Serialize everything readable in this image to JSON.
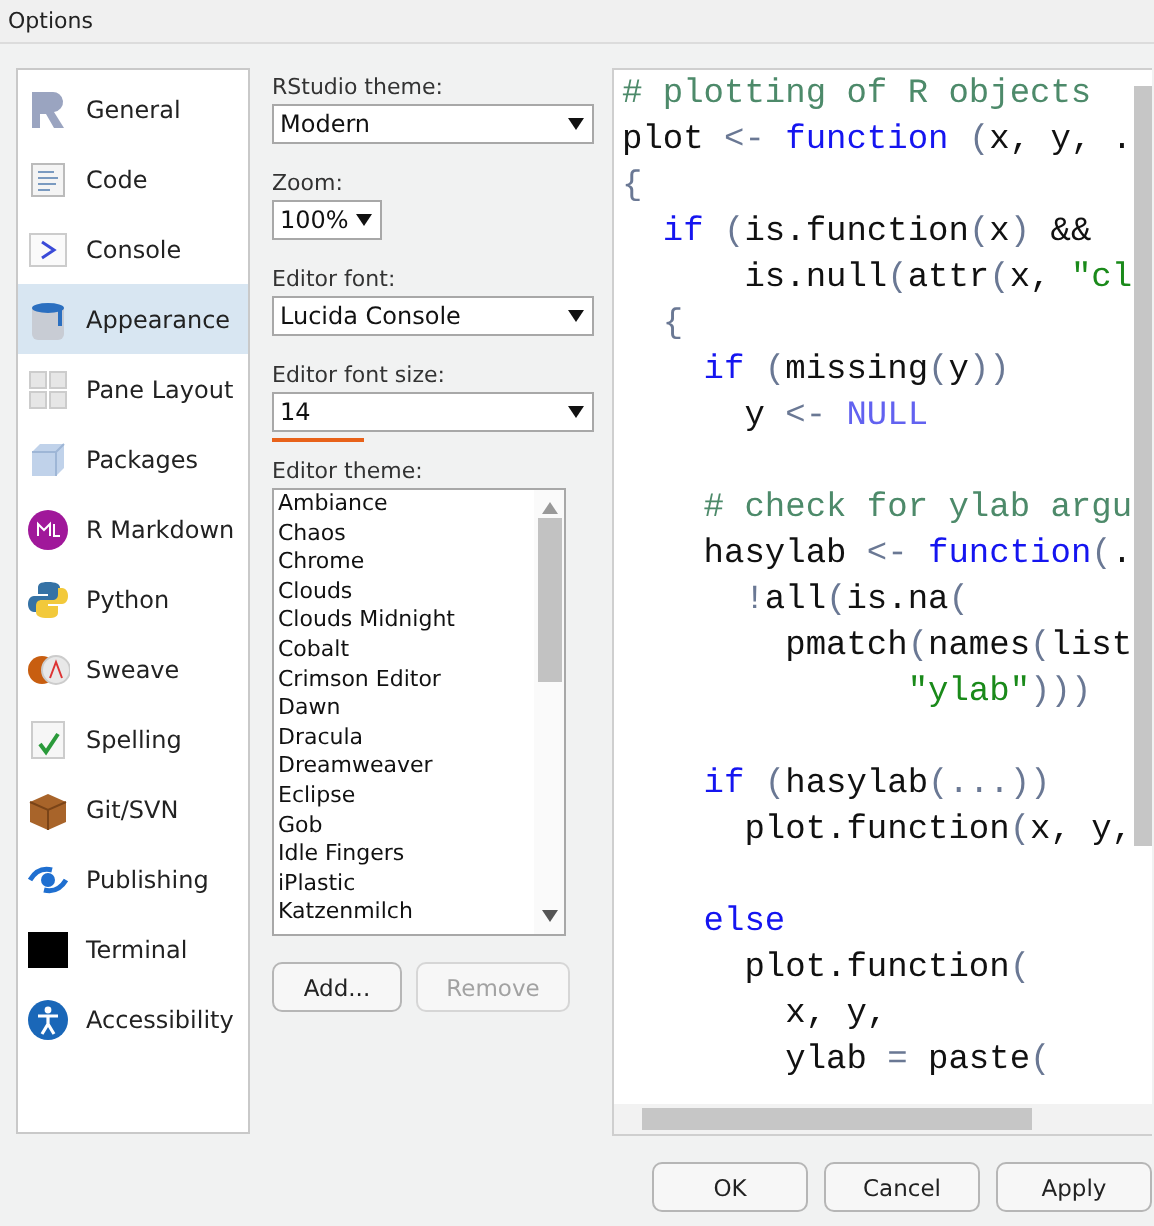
{
  "window": {
    "title": "Options"
  },
  "sidebar": {
    "items": [
      {
        "label": "General",
        "selected": false
      },
      {
        "label": "Code",
        "selected": false
      },
      {
        "label": "Console",
        "selected": false
      },
      {
        "label": "Appearance",
        "selected": true
      },
      {
        "label": "Pane Layout",
        "selected": false
      },
      {
        "label": "Packages",
        "selected": false
      },
      {
        "label": "R Markdown",
        "selected": false
      },
      {
        "label": "Python",
        "selected": false
      },
      {
        "label": "Sweave",
        "selected": false
      },
      {
        "label": "Spelling",
        "selected": false
      },
      {
        "label": "Git/SVN",
        "selected": false
      },
      {
        "label": "Publishing",
        "selected": false
      },
      {
        "label": "Terminal",
        "selected": false
      },
      {
        "label": "Accessibility",
        "selected": false
      }
    ]
  },
  "settings": [
    {
      "label": "RStudio theme:",
      "value": "Modern",
      "wide": true,
      "focused": false
    },
    {
      "label": "Zoom:",
      "value": "100%",
      "wide": false,
      "focused": false
    },
    {
      "label": "Editor font:",
      "value": "Lucida Console",
      "wide": true,
      "focused": false
    },
    {
      "label": "Editor font size:",
      "value": "14",
      "wide": true,
      "focused": true
    }
  ],
  "editor_theme": {
    "label": "Editor theme:",
    "items": [
      "Ambiance",
      "Chaos",
      "Chrome",
      "Clouds",
      "Clouds Midnight",
      "Cobalt",
      "Crimson Editor",
      "Dawn",
      "Dracula",
      "Dreamweaver",
      "Eclipse",
      "Gob",
      "Idle Fingers",
      "iPlastic",
      "Katzenmilch"
    ],
    "buttons": [
      {
        "label": "Add...",
        "disabled": false
      },
      {
        "label": "Remove",
        "disabled": true
      }
    ]
  },
  "preview": {
    "lines": [
      {
        "kind": "code",
        "tokens": [
          {
            "kind": "comment",
            "text": "# plotting of R objects"
          }
        ]
      },
      {
        "kind": "code",
        "tokens": [
          {
            "kind": "plain",
            "text": "plot "
          },
          {
            "kind": "op",
            "text": "<- "
          },
          {
            "kind": "keyword",
            "text": "function"
          },
          {
            "kind": "op",
            "text": " ("
          },
          {
            "kind": "plain",
            "text": "x, y, ."
          }
        ]
      },
      {
        "kind": "code",
        "tokens": [
          {
            "kind": "op",
            "text": "{"
          }
        ]
      },
      {
        "kind": "code",
        "tokens": [
          {
            "kind": "keyword",
            "text": "  if"
          },
          {
            "kind": "op",
            "text": " ("
          },
          {
            "kind": "plain",
            "text": "is.function"
          },
          {
            "kind": "op",
            "text": "("
          },
          {
            "kind": "plain",
            "text": "x"
          },
          {
            "kind": "op",
            "text": ")"
          },
          {
            "kind": "plain",
            "text": " &&"
          }
        ]
      },
      {
        "kind": "code",
        "tokens": [
          {
            "kind": "plain",
            "text": "      is.null"
          },
          {
            "kind": "op",
            "text": "("
          },
          {
            "kind": "plain",
            "text": "attr"
          },
          {
            "kind": "op",
            "text": "("
          },
          {
            "kind": "plain",
            "text": "x, "
          },
          {
            "kind": "string",
            "text": "\"cl"
          }
        ]
      },
      {
        "kind": "code",
        "tokens": [
          {
            "kind": "op",
            "text": "  {"
          }
        ]
      },
      {
        "kind": "code",
        "tokens": [
          {
            "kind": "keyword",
            "text": "    if"
          },
          {
            "kind": "op",
            "text": " ("
          },
          {
            "kind": "plain",
            "text": "missing"
          },
          {
            "kind": "op",
            "text": "("
          },
          {
            "kind": "plain",
            "text": "y"
          },
          {
            "kind": "op",
            "text": "))"
          }
        ]
      },
      {
        "kind": "code",
        "tokens": [
          {
            "kind": "plain",
            "text": "      y "
          },
          {
            "kind": "op",
            "text": "<- "
          },
          {
            "kind": "constant",
            "text": "NULL"
          }
        ]
      },
      {
        "kind": "blank"
      },
      {
        "kind": "code",
        "tokens": [
          {
            "kind": "comment",
            "text": "    # check for ylab argu"
          }
        ]
      },
      {
        "kind": "code",
        "tokens": [
          {
            "kind": "plain",
            "text": "    hasylab "
          },
          {
            "kind": "op",
            "text": "<- "
          },
          {
            "kind": "keyword",
            "text": "function"
          },
          {
            "kind": "op",
            "text": "("
          },
          {
            "kind": "plain",
            "text": "."
          }
        ]
      },
      {
        "kind": "code",
        "tokens": [
          {
            "kind": "op",
            "text": "      !"
          },
          {
            "kind": "plain",
            "text": "all"
          },
          {
            "kind": "op",
            "text": "("
          },
          {
            "kind": "plain",
            "text": "is.na"
          },
          {
            "kind": "op",
            "text": "("
          }
        ]
      },
      {
        "kind": "code",
        "tokens": [
          {
            "kind": "plain",
            "text": "        pmatch"
          },
          {
            "kind": "op",
            "text": "("
          },
          {
            "kind": "plain",
            "text": "names"
          },
          {
            "kind": "op",
            "text": "("
          },
          {
            "kind": "plain",
            "text": "list"
          }
        ]
      },
      {
        "kind": "code",
        "tokens": [
          {
            "kind": "string",
            "text": "              \"ylab\""
          },
          {
            "kind": "op",
            "text": ")))"
          }
        ]
      },
      {
        "kind": "blank"
      },
      {
        "kind": "code",
        "tokens": [
          {
            "kind": "keyword",
            "text": "    if"
          },
          {
            "kind": "op",
            "text": " ("
          },
          {
            "kind": "plain",
            "text": "hasylab"
          },
          {
            "kind": "op",
            "text": "(...))"
          }
        ]
      },
      {
        "kind": "code",
        "tokens": [
          {
            "kind": "plain",
            "text": "      plot.function"
          },
          {
            "kind": "op",
            "text": "("
          },
          {
            "kind": "plain",
            "text": "x, y,"
          }
        ]
      },
      {
        "kind": "blank"
      },
      {
        "kind": "code",
        "tokens": [
          {
            "kind": "keyword",
            "text": "    else"
          }
        ]
      },
      {
        "kind": "code",
        "tokens": [
          {
            "kind": "plain",
            "text": "      plot.function"
          },
          {
            "kind": "op",
            "text": "("
          }
        ]
      },
      {
        "kind": "code",
        "tokens": [
          {
            "kind": "plain",
            "text": "        x, y,"
          }
        ]
      },
      {
        "kind": "code",
        "tokens": [
          {
            "kind": "plain",
            "text": "        ylab "
          },
          {
            "kind": "op",
            "text": "="
          },
          {
            "kind": "plain",
            "text": " paste"
          },
          {
            "kind": "op",
            "text": "("
          }
        ]
      }
    ]
  },
  "buttons": [
    {
      "label": "OK"
    },
    {
      "label": "Cancel"
    },
    {
      "label": "Apply"
    }
  ]
}
